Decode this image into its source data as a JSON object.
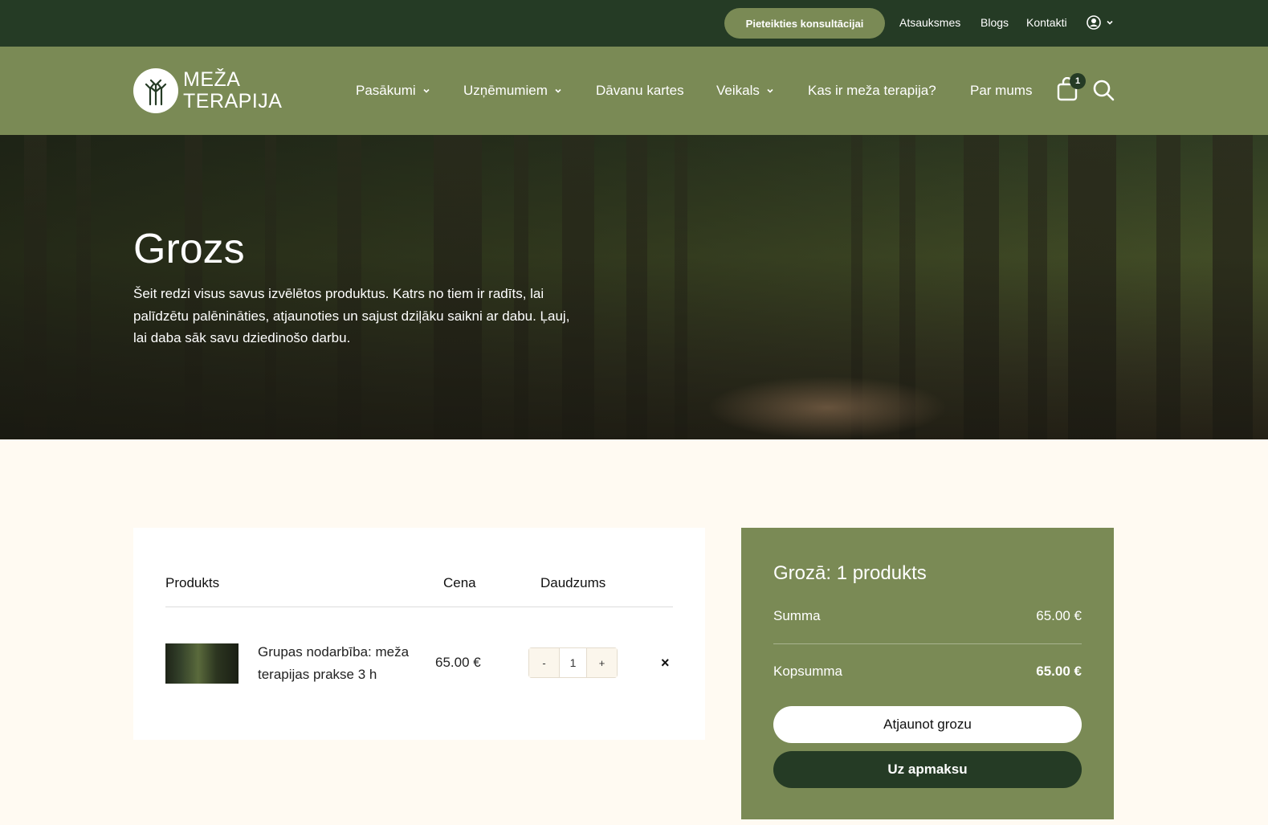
{
  "topbar": {
    "consult_label": "Pieteikties konsultācijai",
    "links": [
      "Atsauksmes",
      "Blogs",
      "Kontakti"
    ]
  },
  "logo": {
    "line1": "MEŽA",
    "line2": "TERAPIJA"
  },
  "nav": {
    "items": [
      {
        "label": "Pasākumi",
        "has_dropdown": true
      },
      {
        "label": "Uzņēmumiem",
        "has_dropdown": true
      },
      {
        "label": "Dāvanu kartes",
        "has_dropdown": false
      },
      {
        "label": "Veikals",
        "has_dropdown": true
      },
      {
        "label": "Kas ir meža terapija?",
        "has_dropdown": false
      },
      {
        "label": "Par mums",
        "has_dropdown": false
      }
    ],
    "cart_count": "1"
  },
  "hero": {
    "title": "Grozs",
    "text": "Šeit redzi visus savus izvēlētos produktus. Katrs no tiem ir radīts, lai palīdzētu palēnināties, atjaunoties un sajust dziļāku saikni ar dabu. Ļauj, lai daba sāk savu dziedinošo darbu."
  },
  "cart": {
    "headers": {
      "product": "Produkts",
      "price": "Cena",
      "quantity": "Daudzums"
    },
    "item": {
      "name": "Grupas nodarbība: meža terapijas prakse 3 h",
      "price": "65.00 €",
      "quantity": "1",
      "minus": "-",
      "plus": "+",
      "remove": "×"
    }
  },
  "summary": {
    "title": "Grozā: 1 produkts",
    "subtotal_label": "Summa",
    "subtotal_value": "65.00 €",
    "total_label": "Kopsumma",
    "total_value": "65.00 €",
    "update_label": "Atjaunot grozu",
    "checkout_label": "Uz apmaksu"
  },
  "colors": {
    "dark_green": "#253b25",
    "olive": "#7a8a55",
    "cream": "#fffaf2"
  },
  "icons": [
    "user-icon",
    "chevron-down-icon",
    "cart-icon",
    "search-icon",
    "close-icon",
    "tree-logo-icon"
  ]
}
